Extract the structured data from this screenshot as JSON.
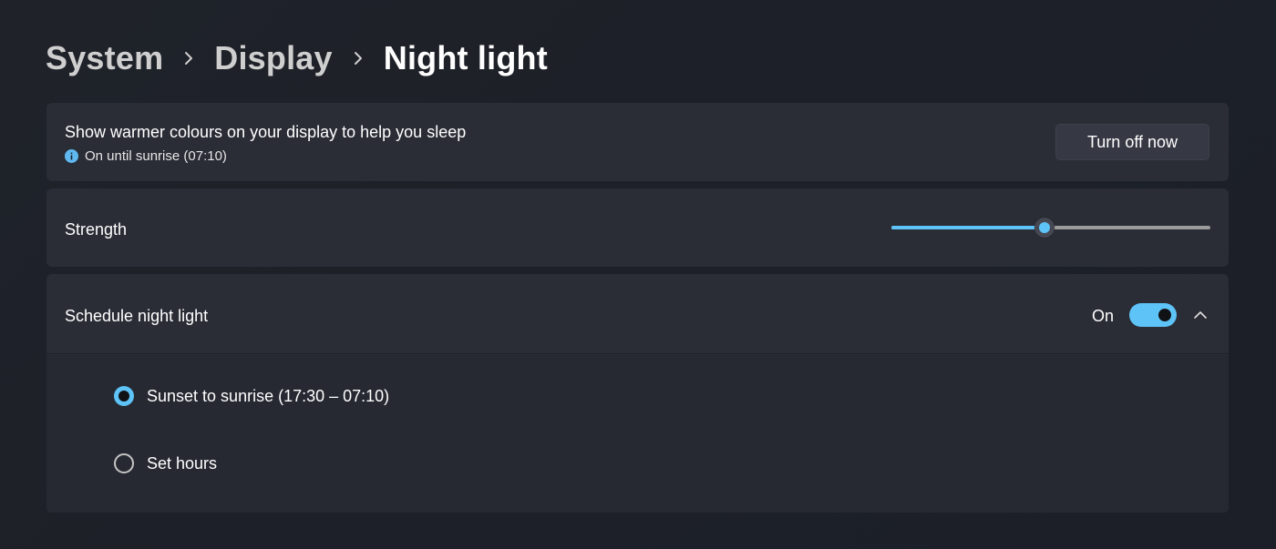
{
  "breadcrumb": {
    "items": [
      "System",
      "Display"
    ],
    "current": "Night light"
  },
  "intro": {
    "description": "Show warmer colours on your display to help you sleep",
    "status": "On until sunrise (07:10)",
    "status_icon": "info-icon",
    "turn_off_label": "Turn off now"
  },
  "strength": {
    "label": "Strength",
    "value_fraction": 0.48
  },
  "schedule": {
    "label": "Schedule night light",
    "toggle_state": "On",
    "toggle_on": true,
    "expanded": true,
    "options": [
      {
        "label": "Sunset to sunrise (17:30 – 07:10)",
        "checked": true
      },
      {
        "label": "Set hours",
        "checked": false
      }
    ]
  },
  "colors": {
    "accent": "#5ec3f7",
    "card": "#2a2d36",
    "background": "#1f2229"
  }
}
